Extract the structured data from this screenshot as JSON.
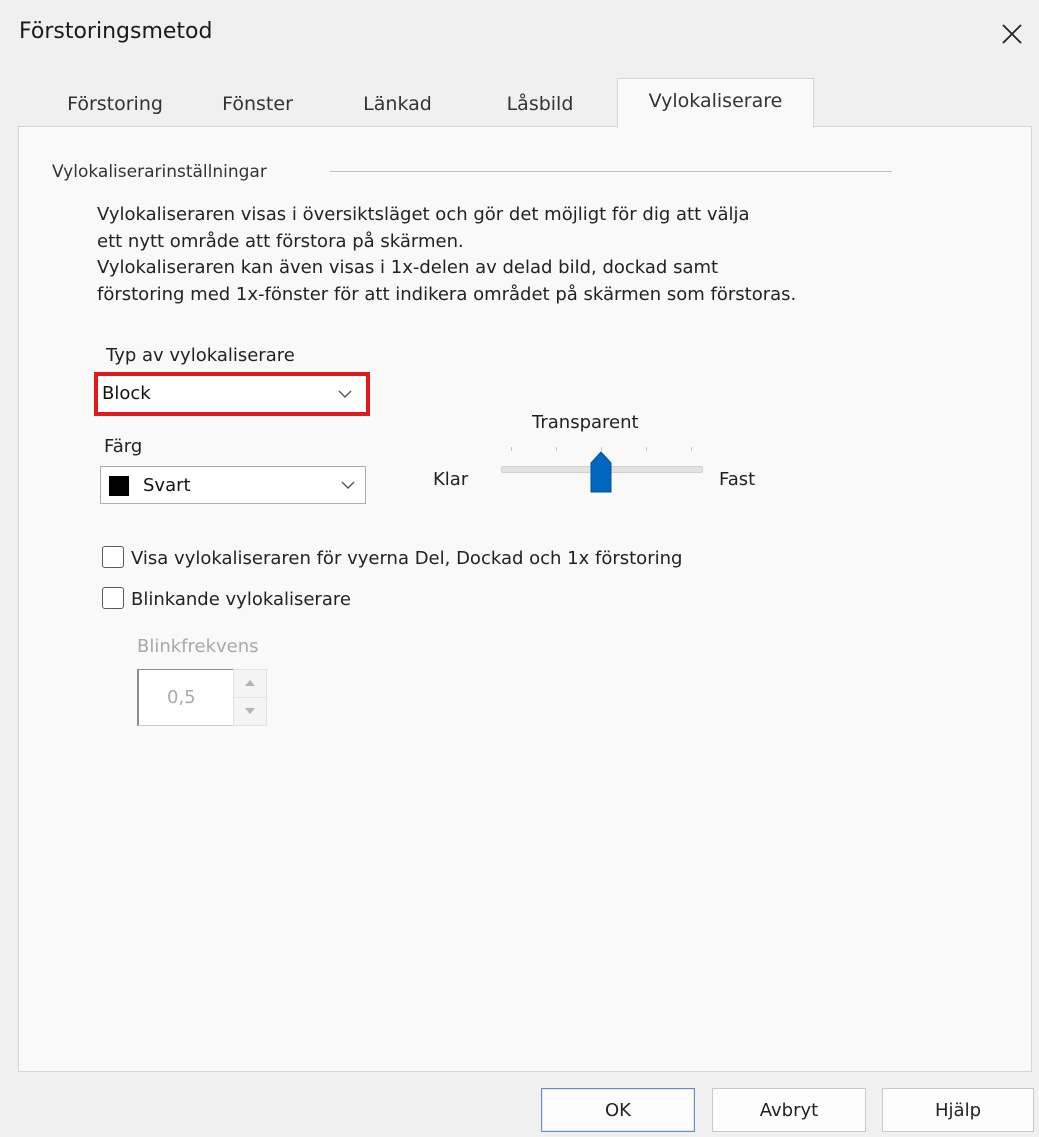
{
  "window": {
    "title": "Förstoringsmetod",
    "close_icon": "close-icon"
  },
  "tabs": [
    {
      "label": "Förstoring",
      "active": false
    },
    {
      "label": "Fönster",
      "active": false
    },
    {
      "label": "Länkad",
      "active": false
    },
    {
      "label": "Låsbild",
      "active": false
    },
    {
      "label": "Vylokaliserare",
      "active": true
    }
  ],
  "settings": {
    "group_label": "Vylokaliserarinställningar",
    "description": [
      "Vylokaliseraren visas i översiktsläget och gör det möjligt för dig att välja",
      "ett nytt område att förstora på skärmen.",
      "Vylokaliseraren kan även visas i 1x-delen av delad bild, dockad samt",
      "förstoring med 1x-fönster för att indikera området på skärmen som förstoras."
    ],
    "type_label": "Typ av vylokaliserare",
    "type_value": "Block",
    "color_label": "Färg",
    "color_value": "Svart",
    "color_swatch": "#000000",
    "transparency": {
      "label": "Transparent",
      "min_label": "Klar",
      "max_label": "Fast",
      "level": 0.5
    },
    "show_in_views": {
      "label": "Visa vylokaliseraren för vyerna Del, Dockad och 1x förstoring",
      "checked": false
    },
    "blinking": {
      "label": "Blinkande vylokaliserare",
      "checked": false
    },
    "blink_frequency": {
      "label": "Blinkfrekvens",
      "value": "0,5",
      "enabled": false
    }
  },
  "highlight_color": "#e01b1b",
  "accent_color": "#0067c0",
  "buttons": {
    "ok": "OK",
    "cancel": "Avbryt",
    "help": "Hjälp"
  }
}
